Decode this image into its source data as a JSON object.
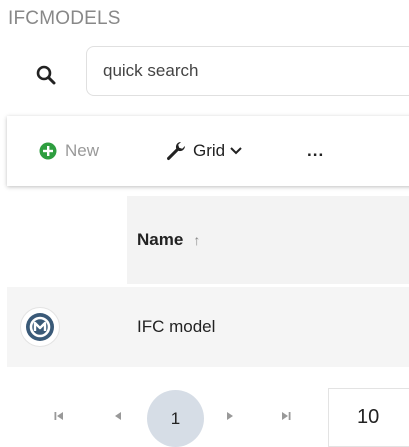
{
  "header": {
    "title": "IFCMODELS"
  },
  "search": {
    "icon": "search-icon",
    "placeholder": "quick search",
    "value": ""
  },
  "toolbar": {
    "new_label": "New",
    "new_icon": "plus-circle-icon",
    "grid_label": "Grid",
    "grid_icon": "wrench-icon",
    "more_label": "..."
  },
  "grid": {
    "columns": [
      {
        "label": "Name",
        "sort": "ascending"
      }
    ],
    "rows": [
      {
        "name": "IFC model",
        "icon": "model-logo-icon"
      }
    ]
  },
  "pager": {
    "current_page": "1",
    "page_size": "10"
  },
  "colors": {
    "accent_green": "#2e9e3f",
    "avatar_blue": "#3a5a78",
    "current_page_bg": "#d6dde6"
  }
}
